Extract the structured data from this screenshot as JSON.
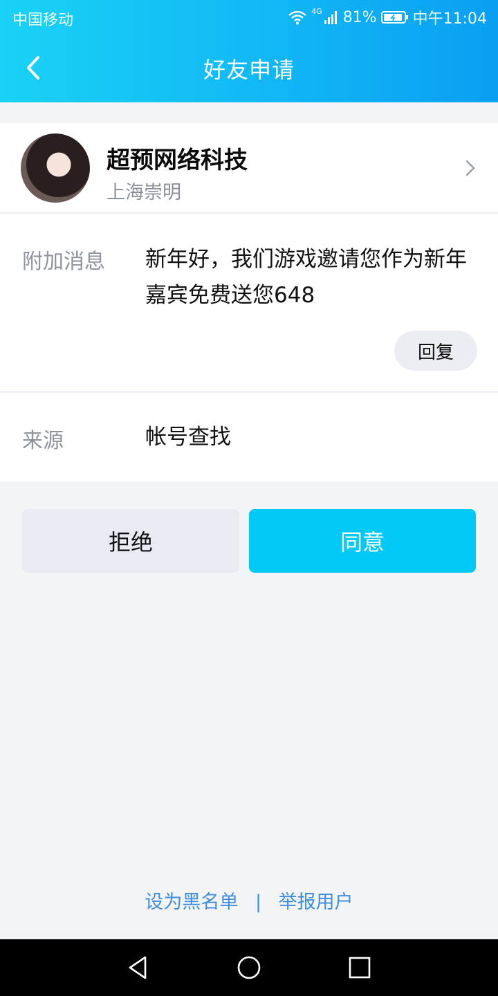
{
  "status_bar": {
    "carrier": "中国移动",
    "network": "4G",
    "battery": "81%",
    "time": "中午11:04"
  },
  "nav": {
    "title": "好友申请",
    "back_icon": "chevron-left-icon"
  },
  "profile": {
    "name": "超预网络科技",
    "location": "上海崇明"
  },
  "message": {
    "label": "附加消息",
    "text": "新年好，我们游戏邀请您作为新年嘉宾免费送您648",
    "reply_label": "回复"
  },
  "source": {
    "label": "来源",
    "value": "帐号查找"
  },
  "actions": {
    "reject_label": "拒绝",
    "accept_label": "同意"
  },
  "footer": {
    "blacklist_label": "设为黑名单",
    "separator": "|",
    "report_label": "举报用户"
  },
  "colors": {
    "accent": "#03c9f8",
    "link": "#3f8edb",
    "background": "#f2f4f8"
  }
}
